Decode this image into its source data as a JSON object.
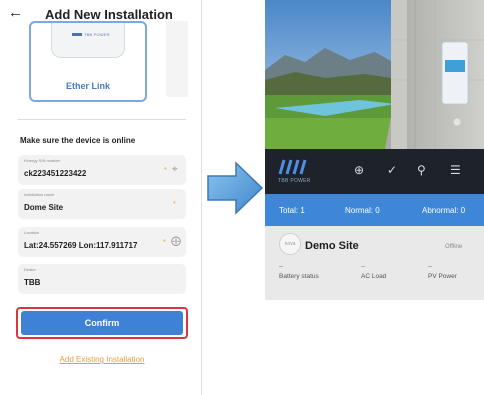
{
  "left": {
    "header": {
      "back_icon": "arrow-left-icon",
      "title": "Add New Installation"
    },
    "connection_card": {
      "label": "Ether Link",
      "device_brand": "TBB POWER"
    },
    "online_notice": "Make sure the device is online",
    "fields": [
      {
        "label": "Kinergy S/N number",
        "value": "ck223451223422",
        "required": "*",
        "icon": "scan-icon"
      },
      {
        "label": "Installation name",
        "value": "Dome Site",
        "required": "*"
      },
      {
        "label": "Location",
        "value": "Lat:24.557269 Lon:117.911717",
        "required": "*",
        "icon": "locate-icon"
      },
      {
        "label": "Dealer",
        "value": "TBB"
      }
    ],
    "confirm_label": "Confirm",
    "add_existing_label": "Add Existing Installation"
  },
  "right": {
    "brand_text": "TBB POWER",
    "toolbar_icons": [
      "add-circle-icon",
      "check-circle-icon",
      "search-icon",
      "menu-icon"
    ],
    "summary": {
      "total": "Total: 1",
      "normal": "Normal: 0",
      "abnormal": "Abnormal: 0"
    },
    "site": {
      "logo_text": "nova",
      "name": "Demo Site",
      "status": "Offline",
      "metrics": [
        {
          "value": "--",
          "label": "Battery status"
        },
        {
          "value": "--",
          "label": "AC Load"
        },
        {
          "value": "--",
          "label": "PV Power"
        }
      ]
    }
  },
  "colors": {
    "accent_blue": "#3f81d6",
    "highlight_red": "#d9363e",
    "link_orange": "#e0a33a",
    "toolbar_dark": "#1e232b",
    "arrow_blue": "#5ea8de"
  }
}
